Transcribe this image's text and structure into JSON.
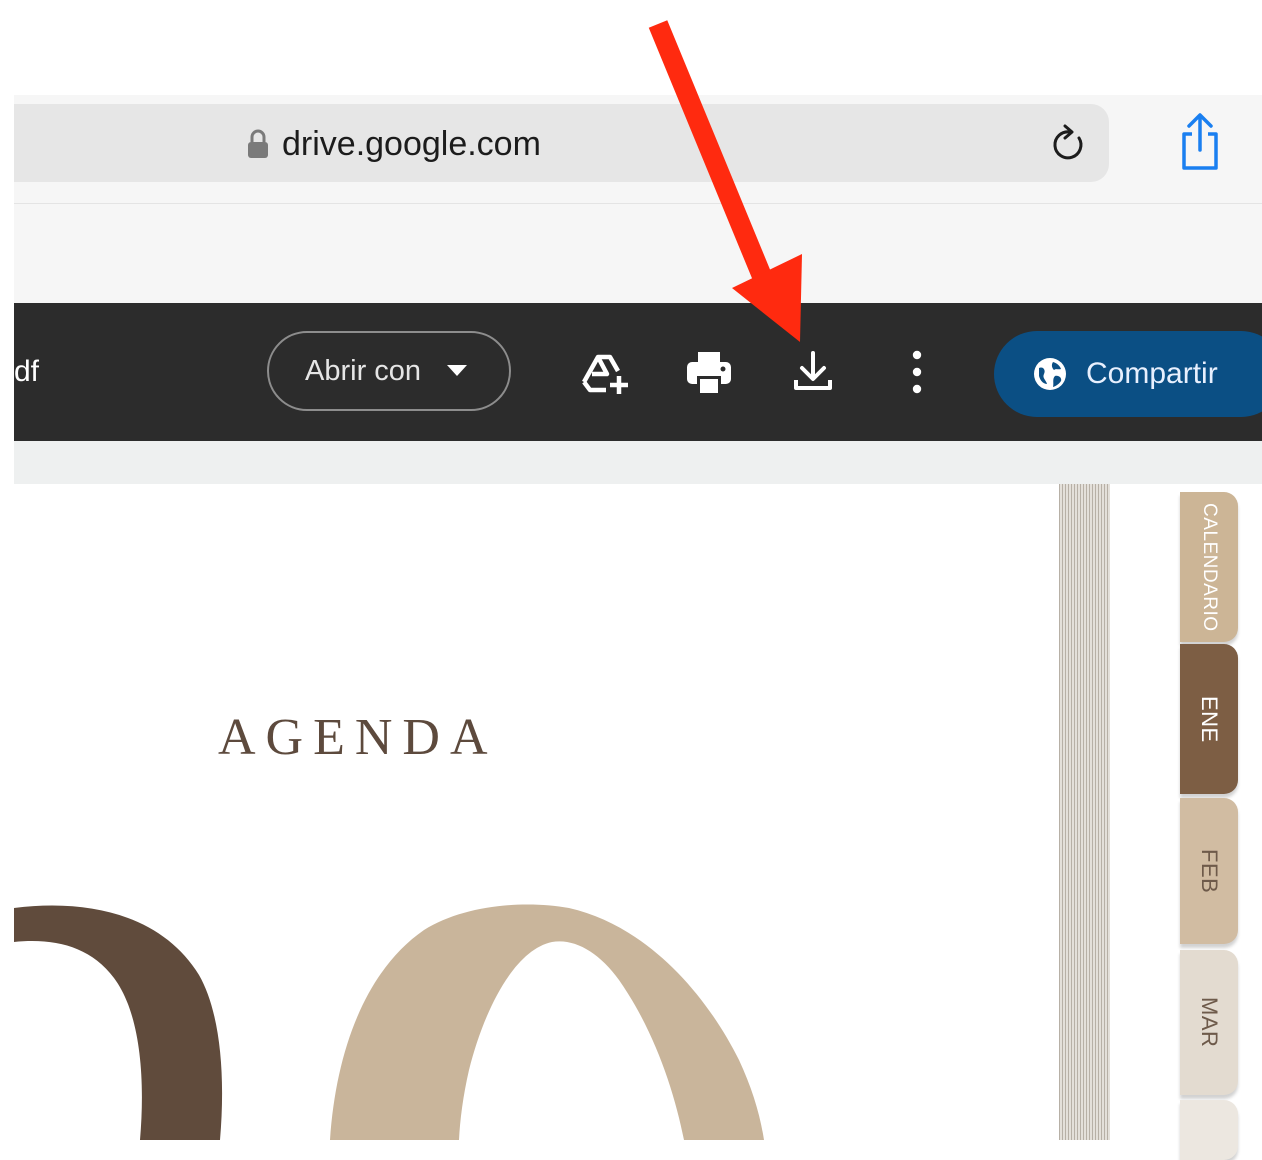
{
  "browser": {
    "url": "drive.google.com"
  },
  "viewer": {
    "file_name_fragment": "df",
    "open_with_label": "Abrir con",
    "share_label": "Compartir",
    "icons": [
      "add-shortcut-icon",
      "print-icon",
      "download-icon",
      "more-vert-icon",
      "globe-icon"
    ]
  },
  "document": {
    "heading": "AGENDA",
    "tabs": [
      "CALENDARIO",
      "ENE",
      "FEB",
      "MAR"
    ]
  },
  "colors": {
    "toolbar_bg": "#2c2c2c",
    "share_button": "#0b4f84",
    "arrow": "#ff2a0f",
    "brown_dark": "#604b3c",
    "tan": "#c9b59b",
    "tab_ene": "#7d5e44"
  }
}
